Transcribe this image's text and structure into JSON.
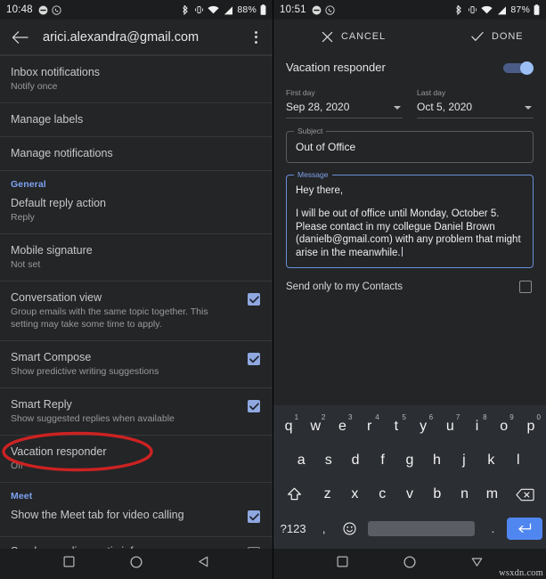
{
  "left": {
    "statusbar": {
      "time": "10:48",
      "battery_percent": "88%",
      "icons": [
        "do-not-disturb-icon",
        "whatsapp-icon",
        "bluetooth-icon",
        "vibrate-icon",
        "wifi-icon",
        "signal-icon",
        "battery-icon"
      ]
    },
    "appbar": {
      "back_icon": "back-arrow-icon",
      "title": "arici.alexandra@gmail.com",
      "overflow_icon": "more-vertical-icon"
    },
    "settings": [
      {
        "type": "item",
        "title": "Inbox notifications",
        "subtitle": "Notify once",
        "checkbox": null
      },
      {
        "type": "item",
        "title": "Manage labels",
        "subtitle": "",
        "checkbox": null
      },
      {
        "type": "item",
        "title": "Manage notifications",
        "subtitle": "",
        "checkbox": null
      },
      {
        "type": "header",
        "title": "General"
      },
      {
        "type": "item",
        "title": "Default reply action",
        "subtitle": "Reply",
        "checkbox": null
      },
      {
        "type": "item",
        "title": "Mobile signature",
        "subtitle": "Not set",
        "checkbox": null
      },
      {
        "type": "item",
        "title": "Conversation view",
        "subtitle": "Group emails with the same topic together. This setting may take some time to apply.",
        "checkbox": "checked"
      },
      {
        "type": "item",
        "title": "Smart Compose",
        "subtitle": "Show predictive writing suggestions",
        "checkbox": "checked"
      },
      {
        "type": "item",
        "title": "Smart Reply",
        "subtitle": "Show suggested replies when available",
        "checkbox": "checked"
      },
      {
        "type": "item",
        "title": "Vacation responder",
        "subtitle": "Off",
        "checkbox": null,
        "annotated": true
      },
      {
        "type": "header",
        "title": "Meet"
      },
      {
        "type": "item",
        "title": "Show the Meet tab for video calling",
        "subtitle": "",
        "checkbox": "checked"
      },
      {
        "type": "item",
        "title": "Send more diagnostic info",
        "subtitle": "",
        "checkbox": "empty"
      }
    ],
    "annotation": {
      "shape": "ellipse",
      "color": "#cc2222",
      "target": "Vacation responder"
    },
    "navbar": [
      "recents-square-icon",
      "home-circle-icon",
      "back-triangle-icon"
    ]
  },
  "right": {
    "statusbar": {
      "time": "10:51",
      "battery_percent": "87%",
      "icons": [
        "do-not-disturb-icon",
        "whatsapp-icon",
        "bluetooth-icon",
        "vibrate-icon",
        "wifi-icon",
        "signal-icon",
        "battery-icon"
      ]
    },
    "actionbar": {
      "cancel_label": "CANCEL",
      "cancel_icon": "close-x-icon",
      "done_label": "DONE",
      "done_icon": "check-icon"
    },
    "toggle": {
      "label": "Vacation responder",
      "state": "on"
    },
    "first_day": {
      "label": "First day",
      "value": "Sep 28, 2020"
    },
    "last_day": {
      "label": "Last day",
      "value": "Oct 5, 2020"
    },
    "subject": {
      "label": "Subject",
      "value": "Out of Office",
      "focused": false
    },
    "message": {
      "label": "Message",
      "focused": true,
      "line1": "Hey there,",
      "body": "I will be out of office until Monday, October 5. Please contact in my collegue Daniel Brown (danielb@gmail.com) with any problem that might arise in the meanwhile."
    },
    "contacts_only": {
      "label": "Send only to my Contacts",
      "checked": false
    },
    "keyboard": {
      "row1": [
        {
          "k": "q",
          "n": "1"
        },
        {
          "k": "w",
          "n": "2"
        },
        {
          "k": "e",
          "n": "3"
        },
        {
          "k": "r",
          "n": "4"
        },
        {
          "k": "t",
          "n": "5"
        },
        {
          "k": "y",
          "n": "6"
        },
        {
          "k": "u",
          "n": "7"
        },
        {
          "k": "i",
          "n": "8"
        },
        {
          "k": "o",
          "n": "9"
        },
        {
          "k": "p",
          "n": "0"
        }
      ],
      "row2": [
        {
          "k": "a"
        },
        {
          "k": "s"
        },
        {
          "k": "d"
        },
        {
          "k": "f"
        },
        {
          "k": "g"
        },
        {
          "k": "h"
        },
        {
          "k": "j"
        },
        {
          "k": "k"
        },
        {
          "k": "l"
        }
      ],
      "row3": [
        {
          "k": "z"
        },
        {
          "k": "x"
        },
        {
          "k": "c"
        },
        {
          "k": "v"
        },
        {
          "k": "b"
        },
        {
          "k": "n"
        },
        {
          "k": "m"
        }
      ],
      "shift_icon": "shift-up-arrow-icon",
      "backspace_icon": "backspace-icon",
      "symbols_label": "?123",
      "comma_label": ",",
      "emoji_icon": "emoji-smiley-icon",
      "period_label": ".",
      "enter_icon": "enter-return-icon"
    },
    "navbar": [
      "recents-square-icon",
      "home-circle-icon",
      "back-triangle-icon"
    ],
    "watermark": "wsxdn.com"
  },
  "colors": {
    "background": "#232527",
    "statusbar": "#1b1d1e",
    "accent_blue": "#7da2f0",
    "checkbox_blue": "#8fa8e0",
    "enter_key_blue": "#5086ef",
    "annotation_red": "#cc2222"
  }
}
